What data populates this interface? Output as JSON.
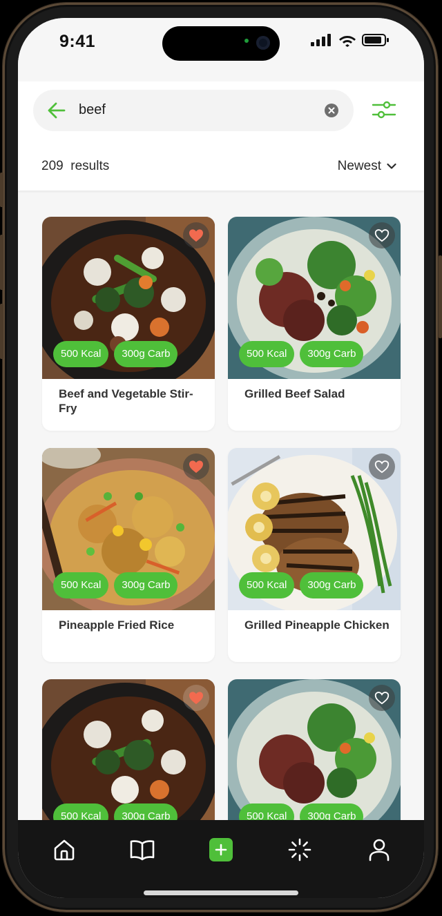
{
  "status_bar": {
    "time": "9:41"
  },
  "search": {
    "query": "beef"
  },
  "results": {
    "count": "209",
    "label": "results",
    "sort_label": "Newest"
  },
  "recipes": [
    {
      "title": "Beef and Vegetable Stir-Fry",
      "kcal": "500 Kcal",
      "carb": "300g Carb",
      "favorited": true
    },
    {
      "title": "Grilled Beef Salad",
      "kcal": "500 Kcal",
      "carb": "300g Carb",
      "favorited": false
    },
    {
      "title": "Pineapple Fried Rice",
      "kcal": "500 Kcal",
      "carb": "300g Carb",
      "favorited": true
    },
    {
      "title": "Grilled Pineapple Chicken",
      "kcal": "500 Kcal",
      "carb": "300g Carb",
      "favorited": false
    },
    {
      "title": "",
      "kcal": "500 Kcal",
      "carb": "300g Carb",
      "favorited": true
    },
    {
      "title": "",
      "kcal": "500 Kcal",
      "carb": "300g Carb",
      "favorited": false
    }
  ],
  "tab_bar": {
    "items": [
      "home-icon",
      "book-icon",
      "add-icon",
      "loader-icon",
      "user-icon"
    ]
  },
  "colors": {
    "accent": "#4fbf3a",
    "heart": "#f26a4f",
    "tabbar": "#151515"
  }
}
